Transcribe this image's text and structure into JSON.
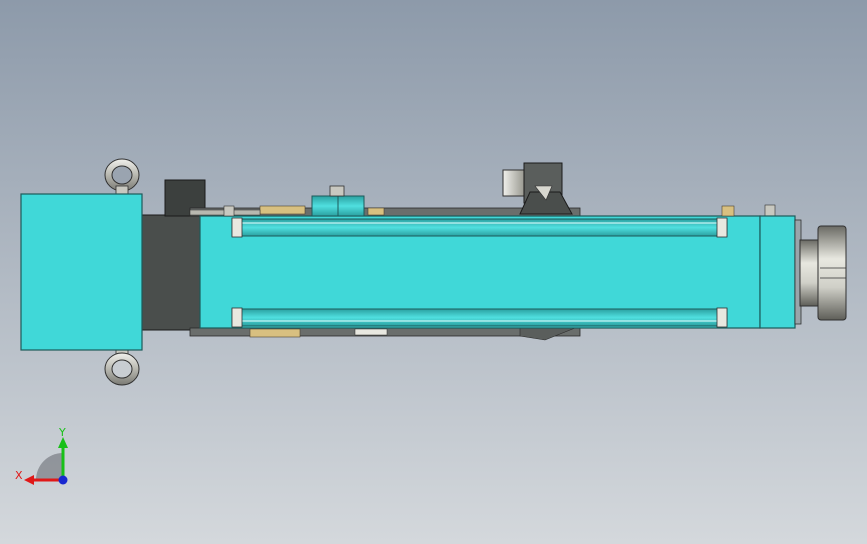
{
  "viewport": {
    "background_top": "#8d9aaa",
    "background_bottom": "#d4d8dc"
  },
  "model": {
    "body_color": "#40d8d8",
    "body_edge": "#1c5a5a",
    "housing_color": "#4a4e4c",
    "metal_color": "#c8c8c0",
    "gold_color": "#d8c080"
  },
  "triad": {
    "x_label": "X",
    "y_label": "Y",
    "x_color": "#e01818",
    "y_color": "#18c018",
    "z_color": "#1828d0"
  }
}
